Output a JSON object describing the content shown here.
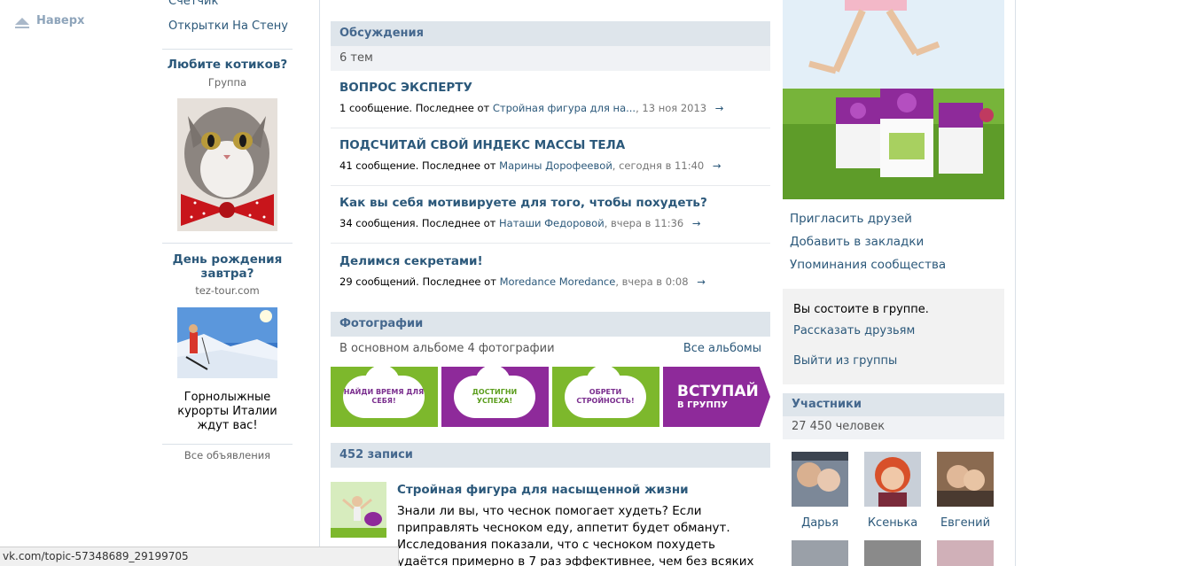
{
  "nav": {
    "to_top": "Наверх"
  },
  "left_menu": {
    "counter": "Счетчик",
    "postcards": "Открытки На Стену"
  },
  "ads": [
    {
      "title": "Любите котиков?",
      "subtitle": "Группа",
      "text": ""
    },
    {
      "title": "День рождения завтра?",
      "subtitle": "tez-tour.com",
      "text": "Горнолыжные курорты Италии ждут вас!"
    }
  ],
  "all_ads": "Все объявления",
  "discussions": {
    "header": "Обсуждения",
    "count": "6 тем",
    "topics": [
      {
        "title": "ВОПРОС ЭКСПЕРТУ",
        "meta_prefix": "1 сообщение. Последнее от ",
        "author": "Стройная фигура для на...",
        "time": ", 13 ноя 2013"
      },
      {
        "title": "ПОДСЧИТАЙ СВОЙ ИНДЕКС МАССЫ ТЕЛА",
        "meta_prefix": "41 сообщение. Последнее от ",
        "author": "Марины Дорофеевой",
        "time": ", сегодня в 11:40"
      },
      {
        "title": "Как вы себя мотивируете для того, чтобы похудеть?",
        "meta_prefix": "34 сообщения. Последнее от ",
        "author": "Наташи Федоровой",
        "time": ", вчера в 11:36"
      },
      {
        "title": "Делимся секретами!",
        "meta_prefix": "29 сообщений. Последнее от ",
        "author": "Moredance Moredance",
        "time": ", вчера в 0:08"
      }
    ],
    "arrow": "→"
  },
  "photos": {
    "header": "Фотографии",
    "album_info": "В основном альбоме 4 фотографии",
    "all_albums": "Все альбомы",
    "banners": [
      {
        "text": "НАЙДИ ВРЕМЯ ДЛЯ СЕБЯ!",
        "bg": "#7DB82C",
        "fg": "#7A2E8E"
      },
      {
        "text": "ДОСТИГНИ УСПЕХА!",
        "bg": "#8E2A9A",
        "fg": "#5C9E1E"
      },
      {
        "text": "ОБРЕТИ СТРОЙНОСТЬ!",
        "bg": "#7DB82C",
        "fg": "#7A2E8E"
      },
      {
        "text_main": "ВСТУПАЙ",
        "text_sub": "В ГРУППУ",
        "bg": "#8E2A9A"
      }
    ]
  },
  "wall": {
    "header": "452 записи",
    "post_title": "Стройная фигура для насыщенной жизни",
    "post_text": "Знали ли вы, что чеснок помогает худеть? Если приправлять чесноком еду, аппетит будет обманут. Исследования показали, что с чесноком похудеть удаётся примерно в 7 раз эффективнее, чем без всяких специй."
  },
  "right": {
    "links": [
      "Пригласить друзей",
      "Добавить в закладки",
      "Упоминания сообщества"
    ],
    "member_status": "Вы состоите в группе.",
    "tell_friends": "Рассказать друзьям",
    "leave_group": "Выйти из группы",
    "members_header": "Участники",
    "members_count": "27 450 человек",
    "members": [
      "Дарья",
      "Ксенька",
      "Евгений"
    ]
  },
  "status_bar": "vk.com/topic-57348689_29199705",
  "colors": {
    "link": "#2B587A",
    "header_bg": "#DEE5EB",
    "header_text": "#45688E",
    "green": "#7DB82C",
    "purple": "#8E2A9A"
  }
}
